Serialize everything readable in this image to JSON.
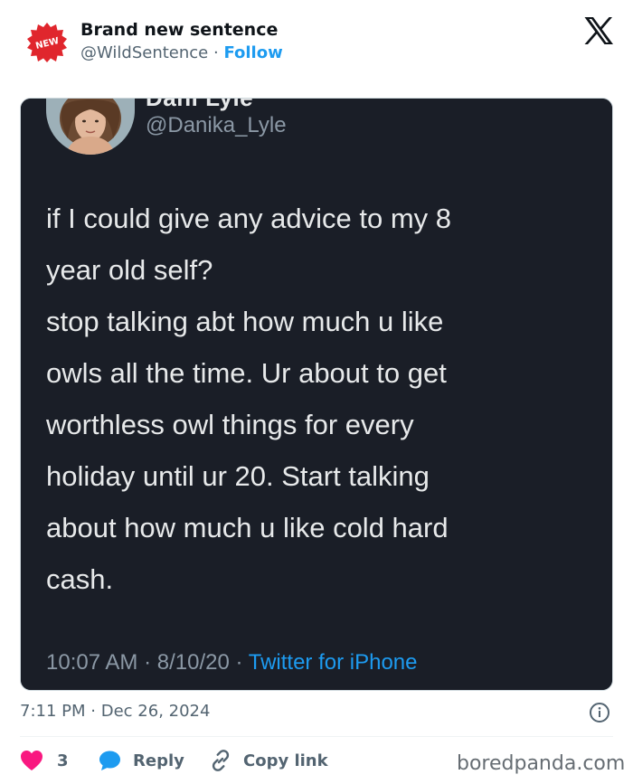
{
  "header": {
    "badge_text": "NEW",
    "author_name": "Brand new sentence",
    "author_handle": "@WildSentence",
    "separator": "·",
    "follow_label": "Follow",
    "platform_icon": "x-logo-icon"
  },
  "embedded_tweet": {
    "author_name_partial": "Dani Lyle",
    "author_handle": "@Danika_Lyle",
    "paragraphs": [
      "if I could give any advice to my 8 year old self?",
      "stop talking abt how much u like owls all the time. Ur about to get worthless owl things for every holiday until ur 20. Start talking about how much u like cold hard cash."
    ],
    "lines": [
      "if I could give any advice to my 8",
      "year old self?",
      "stop talking abt how much u like",
      "owls all the time. Ur about to get",
      "worthless owl things for every",
      "holiday until ur 20. Start talking",
      "about how much u like cold hard",
      "cash."
    ],
    "time": "10:07 AM",
    "date": "8/10/20",
    "meta_separator": "·",
    "source": "Twitter for iPhone"
  },
  "post_meta": {
    "time": "7:11 PM",
    "separator": "·",
    "date": "Dec 26, 2024"
  },
  "actions": {
    "like_count": "3",
    "reply_label": "Reply",
    "copy_label": "Copy link"
  },
  "watermark": "boredpanda.com",
  "colors": {
    "accent": "#1d9bf0",
    "like": "#f91880",
    "badge": "#e0262d",
    "embed_bg": "#1a1e27",
    "muted": "#536471"
  }
}
